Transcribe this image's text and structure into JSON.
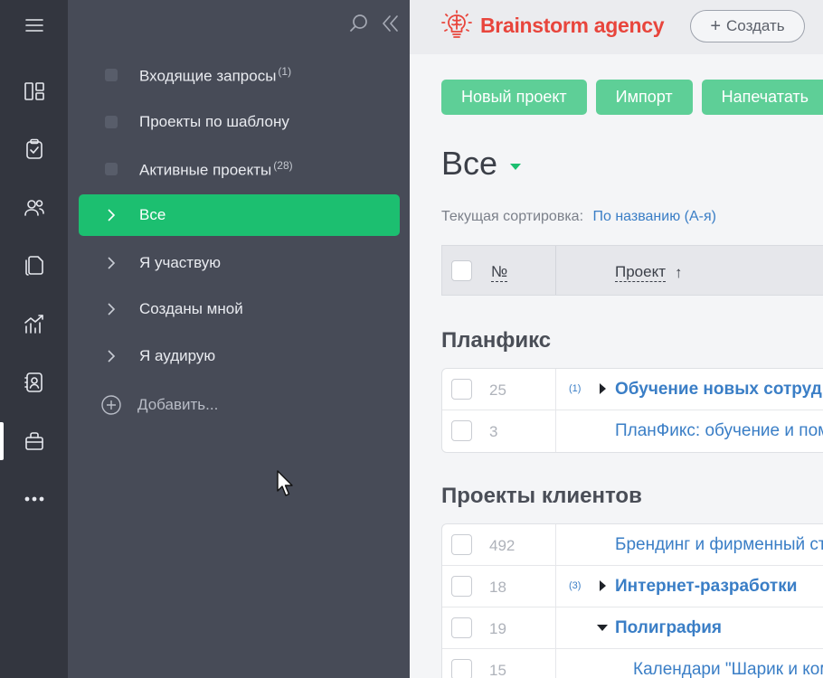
{
  "rail": {
    "items": [
      {
        "icon": "dashboard-icon"
      },
      {
        "icon": "tasks-icon"
      },
      {
        "icon": "contacts-icon"
      },
      {
        "icon": "documents-icon"
      },
      {
        "icon": "reports-icon"
      },
      {
        "icon": "user-card-icon"
      },
      {
        "icon": "projects-icon",
        "active": true
      },
      {
        "icon": "more-icon"
      }
    ]
  },
  "panel": {
    "items": [
      {
        "label": "Входящие запросы",
        "count": "(1)"
      },
      {
        "label": "Проекты по шаблону",
        "count": ""
      },
      {
        "label": "Активные проекты",
        "count": "(28)"
      },
      {
        "label": "Все",
        "count": ""
      },
      {
        "label": "Я участвую",
        "count": ""
      },
      {
        "label": "Созданы мной",
        "count": ""
      },
      {
        "label": "Я аудирую",
        "count": ""
      }
    ],
    "add_label": "Добавить..."
  },
  "header": {
    "brand": "Brainstorm agency",
    "create_label": "Создать"
  },
  "toolbar": {
    "new_project": "Новый проект",
    "import": "Импорт",
    "print": "Напечатать"
  },
  "view": {
    "title": "Все",
    "sort_label": "Текущая сортировка:",
    "sort_value": "По названию (А-я)"
  },
  "table": {
    "col_num": "№",
    "col_project": "Проект",
    "sort_arrow": "↑"
  },
  "groups": [
    {
      "title": "Планфикс",
      "rows": [
        {
          "num": "25",
          "count": "(1)",
          "name": "Обучение новых сотрудников",
          "bold": true,
          "expander": "collapsed"
        },
        {
          "num": "3",
          "count": "",
          "name": "ПланФикс: обучение и помощь",
          "bold": false,
          "expander": "none"
        }
      ]
    },
    {
      "title": "Проекты клиентов",
      "rows": [
        {
          "num": "492",
          "count": "",
          "name": "Брендинг и фирменный стиль",
          "bold": false,
          "expander": "none"
        },
        {
          "num": "18",
          "count": "(3)",
          "name": "Интернет-разработки",
          "bold": true,
          "expander": "collapsed"
        },
        {
          "num": "19",
          "count": "",
          "name": "Полиграфия",
          "bold": true,
          "expander": "expanded"
        },
        {
          "num": "15",
          "count": "",
          "name": "Календари \"Шарик и компания\"",
          "bold": false,
          "expander": "child"
        }
      ]
    }
  ]
}
